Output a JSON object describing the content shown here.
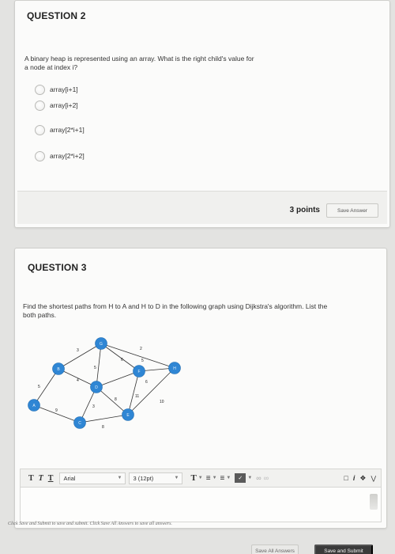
{
  "question2": {
    "title": "QUESTION 2",
    "text_line1": "A binary heap is represented using an array. What is the right child's value for",
    "text_line2": "a node at index i?",
    "options": [
      "array[i+1]",
      "array[i+2]",
      "array[2*i+1]",
      "array[2*i+2]"
    ],
    "points": "3 points",
    "save_label": "Save Answer"
  },
  "question3": {
    "title": "QUESTION 3",
    "text_line1": "Find the shortest paths from H to A and H to D in the following graph using Dijkstra's algorithm. List the",
    "text_line2": "both paths.",
    "graph": {
      "node_color": "#2f86d4",
      "nodes": [
        "A",
        "B",
        "C",
        "D",
        "E",
        "F",
        "G",
        "H"
      ],
      "edge_weights": [
        "3",
        "2",
        "6",
        "5",
        "5",
        "4",
        "5",
        "6",
        "8",
        "11",
        "10",
        "3",
        "9",
        "8"
      ]
    },
    "toolbar": {
      "format_icons": [
        "T",
        "T",
        "T"
      ],
      "font_family": "Arial",
      "font_size": "3 (12pt)",
      "text_color": "T"
    }
  },
  "footer": {
    "note": "Click Save and Submit to save and submit. Click Save All Answers to save all answers.",
    "save_all_label": "Save All Answers",
    "save_submit_label": "Save and Submit"
  }
}
